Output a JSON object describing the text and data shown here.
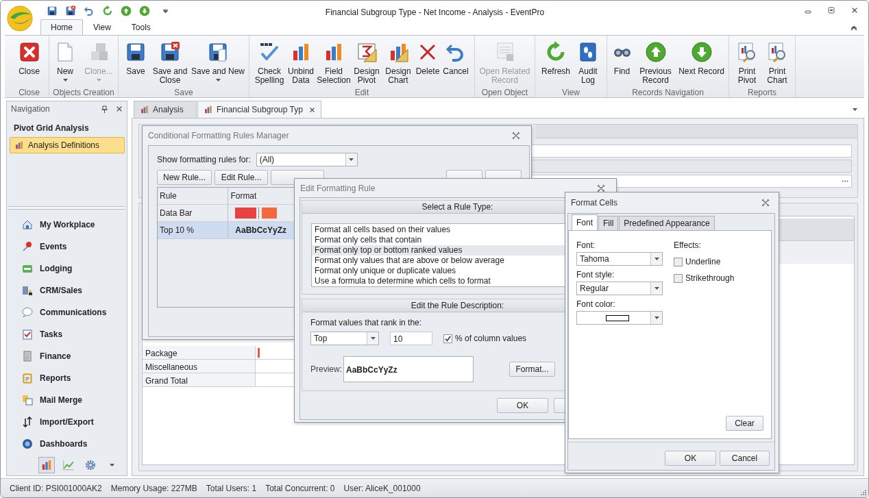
{
  "window": {
    "title": "Financial Subgroup Type - Net Income - Analysis - EventPro"
  },
  "ribbon_tabs": [
    {
      "label": "Home",
      "selected": true
    },
    {
      "label": "View",
      "selected": false
    },
    {
      "label": "Tools",
      "selected": false
    }
  ],
  "ribbon_groups": [
    {
      "label": "Close",
      "buttons": [
        {
          "label": "Close",
          "disabled": false,
          "dropdown": false
        }
      ]
    },
    {
      "label": "Objects Creation",
      "buttons": [
        {
          "label": "New",
          "disabled": false,
          "dropdown": true
        },
        {
          "label": "Clone...",
          "disabled": true,
          "dropdown": true
        }
      ]
    },
    {
      "label": "Save",
      "buttons": [
        {
          "label": "Save",
          "disabled": false,
          "dropdown": false
        },
        {
          "label": "Save and Close",
          "disabled": false,
          "dropdown": false
        },
        {
          "label": "Save and New",
          "disabled": false,
          "dropdown": true
        }
      ]
    },
    {
      "label": "Edit",
      "buttons": [
        {
          "label": "Check Spelling",
          "disabled": false,
          "dropdown": false
        },
        {
          "label": "Unbind Data",
          "disabled": false,
          "dropdown": false
        },
        {
          "label": "Field Selection",
          "disabled": false,
          "dropdown": false
        },
        {
          "label": "Design Pivot",
          "disabled": false,
          "dropdown": false
        },
        {
          "label": "Design Chart",
          "disabled": false,
          "dropdown": false
        },
        {
          "label": "Delete",
          "disabled": false,
          "dropdown": false
        },
        {
          "label": "Cancel",
          "disabled": false,
          "dropdown": false
        }
      ]
    },
    {
      "label": "Open Object",
      "buttons": [
        {
          "label": "Open Related Record",
          "disabled": true,
          "dropdown": false
        }
      ]
    },
    {
      "label": "View",
      "buttons": [
        {
          "label": "Refresh",
          "disabled": false,
          "dropdown": false
        },
        {
          "label": "Audit Log",
          "disabled": false,
          "dropdown": false
        }
      ]
    },
    {
      "label": "Records Navigation",
      "buttons": [
        {
          "label": "Find",
          "disabled": false,
          "dropdown": false
        },
        {
          "label": "Previous Record",
          "disabled": false,
          "dropdown": false
        },
        {
          "label": "Next Record",
          "disabled": false,
          "dropdown": false
        }
      ]
    },
    {
      "label": "Reports",
      "buttons": [
        {
          "label": "Print Pivot",
          "disabled": false,
          "dropdown": false
        },
        {
          "label": "Print Chart",
          "disabled": false,
          "dropdown": false
        }
      ]
    }
  ],
  "navigation": {
    "title": "Navigation",
    "section": "Pivot Grid Analysis",
    "items": [
      {
        "label": "Analysis Definitions",
        "selected": true
      }
    ],
    "modules": [
      "My Workplace",
      "Events",
      "Lodging",
      "CRM/Sales",
      "Communications",
      "Tasks",
      "Finance",
      "Reports",
      "Mail Merge",
      "Import/Export",
      "Dashboards"
    ],
    "views": [
      {
        "selected": true
      },
      {
        "selected": false
      },
      {
        "selected": false
      }
    ]
  },
  "doc_tabs": [
    {
      "label": "Analysis",
      "selected": false
    },
    {
      "label": "Financial Subgroup Typ",
      "selected": true
    }
  ],
  "pivot_rows": [
    {
      "label": "Package",
      "has_bar": true
    },
    {
      "label": "Miscellaneous",
      "has_bar": false
    },
    {
      "label": "Grand Total",
      "has_bar": false
    }
  ],
  "rules_manager": {
    "title": "Conditional Formatting Rules Manager",
    "show_label": "Show formatting rules for:",
    "show_value": "(All)",
    "buttons": [
      "New Rule...",
      "Edit Rule..."
    ],
    "columns": [
      "Rule",
      "Format"
    ],
    "rules": [
      {
        "rule": "Data Bar",
        "kind": "databar",
        "selected": false
      },
      {
        "rule": "Top 10 %",
        "kind": "text",
        "format": "AaBbCcYyZz",
        "selected": true
      }
    ]
  },
  "edit_rule": {
    "title": "Edit Formatting Rule",
    "type_header": "Select a Rule Type:",
    "rule_types": [
      {
        "label": "Format all cells based on their values",
        "selected": false
      },
      {
        "label": "Format only cells that contain",
        "selected": false
      },
      {
        "label": "Format only top or bottom ranked values",
        "selected": true
      },
      {
        "label": "Format only values that are above or below average",
        "selected": false
      },
      {
        "label": "Format only unique or duplicate values",
        "selected": false
      },
      {
        "label": "Use a formula to determine which cells to format",
        "selected": false
      }
    ],
    "desc_header": "Edit the Rule Description:",
    "rank_label": "Format values that rank in the:",
    "rank_mode": "Top",
    "rank_count": "10",
    "percent": {
      "label": "% of column values",
      "checked": true
    },
    "preview_label": "Preview:",
    "preview_text": "AaBbCcYyZz",
    "format_button": "Format...",
    "ok": "OK"
  },
  "format_cells": {
    "title": "Format Cells",
    "tabs": [
      {
        "label": "Font",
        "selected": true
      },
      {
        "label": "Fill",
        "selected": false
      },
      {
        "label": "Predefined Appearance",
        "selected": false
      }
    ],
    "font_label": "Font:",
    "font": "Tahoma",
    "style_label": "Font style:",
    "style": "Regular",
    "color_label": "Font color:",
    "effects_label": "Effects:",
    "effects": [
      {
        "label": "Underline",
        "checked": false
      },
      {
        "label": "Strikethrough",
        "checked": false
      }
    ],
    "clear": "Clear",
    "ok": "OK",
    "cancel": "Cancel"
  },
  "status_bar": [
    "Client ID: PSI001000AK2",
    "Memory Usage: 227MB",
    "Total Users: 1",
    "Total Concurrent: 0",
    "User: AliceK_001000"
  ]
}
